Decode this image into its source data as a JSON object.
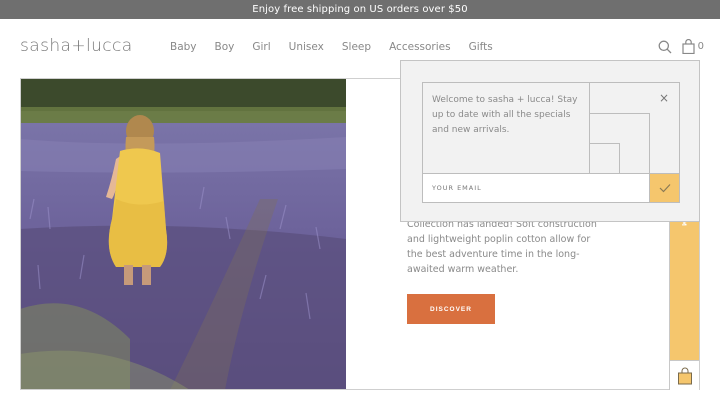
{
  "topbar": {
    "text": "Enjoy free shipping on US orders over $50"
  },
  "header": {
    "logo": "sasha+lucca",
    "nav": [
      "Baby",
      "Boy",
      "Girl",
      "Unisex",
      "Sleep",
      "Accessories",
      "Gifts"
    ],
    "cart_count": "0"
  },
  "hero": {
    "body_text": "Collection has landed! Soft construction and lightweight poplin cotton allow for the best adventure time in the long-awaited warm weather.",
    "cta_label": "DISCOVER"
  },
  "side_tab": {
    "label": "M"
  },
  "popup": {
    "message": "Welcome to sasha + lucca! Stay up to date with all the specials and new arrivals.",
    "email_placeholder": "YOUR EMAIL",
    "close_symbol": "×"
  },
  "colors": {
    "accent_orange": "#d9703f",
    "accent_yellow": "#f5c66d",
    "topbar_gray": "#6f6f6f"
  }
}
